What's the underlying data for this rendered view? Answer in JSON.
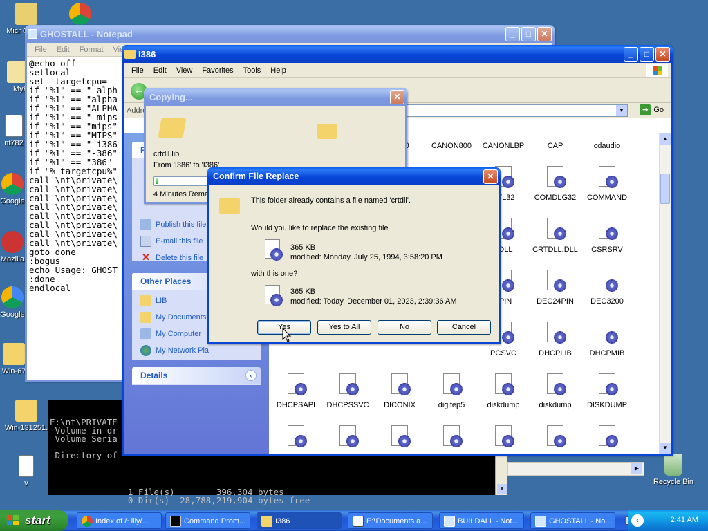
{
  "desktop": {
    "icons": [
      {
        "label": "Micr Out"
      },
      {
        "label": "MyP"
      },
      {
        "label": "nt782"
      },
      {
        "label": "Google"
      },
      {
        "label": "Mozilla"
      },
      {
        "label": "Google"
      },
      {
        "label": "Win-67"
      },
      {
        "label": "Win-131251."
      },
      {
        "label": "v"
      },
      {
        "label": "Recycle Bin"
      }
    ]
  },
  "notepad": {
    "title": "GHOSTALL - Notepad",
    "menu": [
      "File",
      "Edit",
      "Format",
      "View"
    ],
    "text": "@echo off\nsetlocal\nset _targetcpu=\nif \"%1\" == \"-alph\nif \"%1\" == \"alpha\nif \"%1\" == \"ALPHA\nif \"%1\" == \"-mips\nif \"%1\" == \"mips\"\nif \"%1\" == \"MIPS\"\nif \"%1\" == \"-i386\nif \"%1\" == \"-386\"\nif \"%1\" == \"386\"\nif \"%_targetcpu%\"\ncall \\nt\\private\\\ncall \\nt\\private\\\ncall \\nt\\private\\\ncall \\nt\\private\\\ncall \\nt\\private\\\ncall \\nt\\private\\\ncall \\nt\\private\\\ncall \\nt\\private\\\ngoto done\n:bogus\necho Usage: GHOST\n:done\nendlocal"
  },
  "console": {
    "text_top": "E:\\nt\\PRIVATE\n Volume in dr\n Volume Seria\n\n Directory of\n\n07/25/1994  0",
    "text_bottom": "               1 File(s)        396,304 bytes\n               0 Dir(s)  28,788,219,904 bytes free\n\nE:\\nt\\PRIVATE>"
  },
  "explorer": {
    "title": "I386",
    "menu": [
      "File",
      "Edit",
      "View",
      "Favorites",
      "Tools",
      "Help"
    ],
    "address_label": "Addre",
    "go_label": "Go",
    "file_tasks": {
      "links": [
        "Publish this file",
        "E-mail this file",
        "Delete this file"
      ]
    },
    "other_places": {
      "header": "Other Places",
      "links": [
        "LIB",
        "My Documents",
        "My Computer",
        "My Network Pla"
      ]
    },
    "details_header": "Details",
    "files": [
      {
        "name": "...330"
      },
      {
        "name": "CANON800"
      },
      {
        "name": "CANONLBP"
      },
      {
        "name": "CAP"
      },
      {
        "name": "cdaudio"
      },
      {
        "name": "CTL32"
      },
      {
        "name": "COMDLG32"
      },
      {
        "name": "COMMAND"
      },
      {
        "name": "TDLL"
      },
      {
        "name": "CRTDLL.DLL"
      },
      {
        "name": "CSRSRV"
      },
      {
        "name": "9PIN"
      },
      {
        "name": "DEC24PIN"
      },
      {
        "name": "DEC3200"
      },
      {
        "name": "PCSVC"
      },
      {
        "name": "DHCPLIB"
      },
      {
        "name": "DHCPMIB"
      },
      {
        "name": "DHCPSAPI"
      },
      {
        "name": "DHCPSSVC"
      },
      {
        "name": "DICONIX"
      },
      {
        "name": "digifep5"
      },
      {
        "name": "diskdump"
      },
      {
        "name": "diskdump"
      },
      {
        "name": "DISKDUMP"
      },
      {
        "name": "diskperf"
      },
      {
        "name": "DISKREG"
      },
      {
        "name": "DLCAPI"
      },
      {
        "name": "dlttape"
      },
      {
        "name": "DOSPRINT"
      },
      {
        "name": "DPMI32"
      },
      {
        "name": "dptscsi"
      }
    ]
  },
  "copying": {
    "title": "Copying...",
    "filename": "crtdll.lib",
    "from_to": "From 'I386' to 'I386'",
    "progress": 0.05,
    "time_remaining": "4 Minutes Rema"
  },
  "confirm": {
    "title": "Confirm File Replace",
    "message": "This folder already contains a file named 'crtdll'.",
    "question": "Would you like to replace the existing file",
    "existing_size": "365 KB",
    "existing_modified": "modified: Monday, July 25, 1994, 3:58:20 PM",
    "with_this": "with this one?",
    "new_size": "365 KB",
    "new_modified": "modified: Today, December 01, 2023, 2:39:36 AM",
    "buttons": {
      "yes": "Yes",
      "yes_all": "Yes to All",
      "no": "No",
      "cancel": "Cancel"
    }
  },
  "taskbar": {
    "start": "start",
    "items": [
      {
        "label": "Index of /~lily/..."
      },
      {
        "label": "Command Prom..."
      },
      {
        "label": "I386"
      },
      {
        "label": "E:\\Documents a..."
      },
      {
        "label": "BUILDALL - Not..."
      },
      {
        "label": "GHOSTALL - No..."
      }
    ],
    "clock": "2:41 AM"
  }
}
